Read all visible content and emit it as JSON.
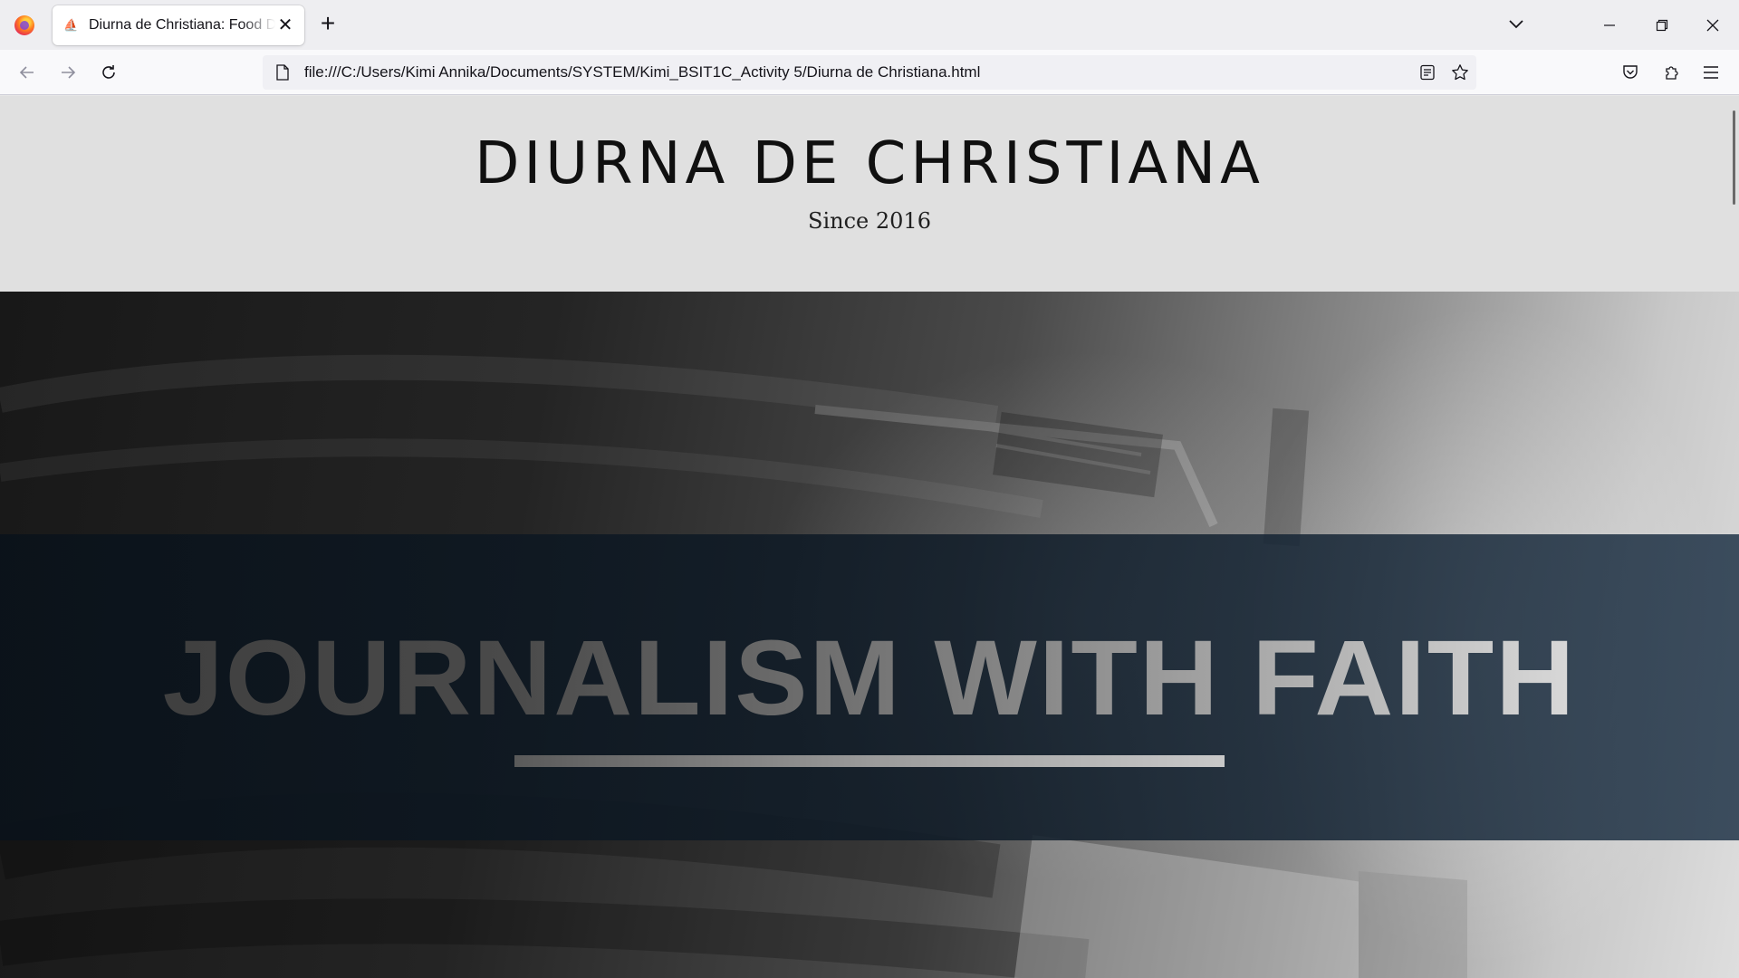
{
  "browser": {
    "tab": {
      "title": "Diurna de Christiana: Food Deli",
      "favicon": "document-favicon-icon",
      "close_icon": "close-icon"
    },
    "new_tab_icon": "plus-icon",
    "list_tabs_icon": "chevron-down-icon",
    "window_controls": [
      "minimize-icon",
      "restore-icon",
      "close-icon"
    ],
    "nav": {
      "back_icon": "arrow-left-icon",
      "forward_icon": "arrow-right-icon",
      "reload_icon": "reload-icon"
    },
    "url": "file:///C:/Users/Kimi Annika/Documents/SYSTEM/Kimi_BSIT1C_Activity 5/Diurna de Christiana.html",
    "url_icons": [
      "page-icon",
      "reader-view-icon",
      "bookmark-star-icon"
    ],
    "toolbar_icons": [
      "pocket-icon",
      "extensions-icon",
      "menu-icon"
    ]
  },
  "page": {
    "header": {
      "title": "DIURNA DE CHRISTIANA",
      "subtitle": "Since 2016",
      "background": "#e0e0e0"
    },
    "hero": {
      "headline": "JOURNALISM WITH FAITH",
      "banner_color": "#0f1b26"
    }
  }
}
